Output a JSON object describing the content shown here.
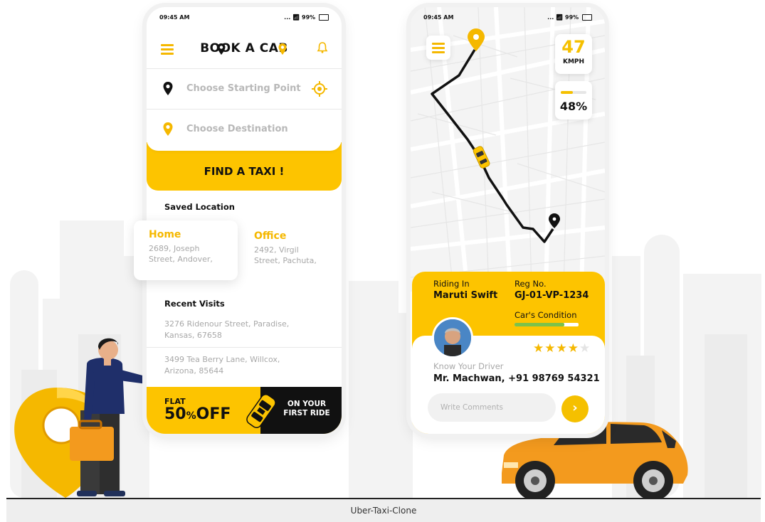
{
  "caption": "Uber-Taxi-Clone",
  "status_bar": {
    "time": "09:45 AM",
    "signal": "...",
    "battery": "99%"
  },
  "booking_screen": {
    "title": "BOOK A CAB",
    "starting_point_placeholder": "Choose Starting Point",
    "destination_placeholder": "Choose Destination",
    "find_button": "FIND A TAXI !",
    "saved_location_title": "Saved Location",
    "saved_locations": [
      {
        "name": "Home",
        "address_line1": "2689,  Joseph",
        "address_line2": "Street, Andover,"
      },
      {
        "name": "Office",
        "address_line1": "2492, Virgil",
        "address_line2": "Street, Pachuta,"
      }
    ],
    "recent_visits_title": "Recent Visits",
    "recent_visits": [
      {
        "line1": "3276  Ridenour Street, Paradise,",
        "line2": "Kansas, 67658"
      },
      {
        "line1": "3499  Tea Berry Lane, Willcox,",
        "line2": "Arizona, 85644"
      }
    ],
    "promo": {
      "flat": "FLAT",
      "discount": "50",
      "percent_sign": "%",
      "off": "OFF",
      "ride_line1": "ON YOUR",
      "ride_line2": "FIRST RIDE"
    }
  },
  "ride_screen": {
    "speed_value": "47",
    "speed_unit": "KMPH",
    "progress_percent": 48,
    "progress_label": "48%",
    "riding_in_label": "Riding In",
    "car_model": "Maruti Swift",
    "reg_label": "Reg No.",
    "reg_number": "GJ-01-VP-1234",
    "condition_label": "Car's Condition",
    "condition_fraction": 0.78,
    "rating": 4,
    "rating_max": 5,
    "know_driver_label": "Know Your Driver",
    "driver_name": "Mr. Machwan, +91 98769 54321",
    "comment_placeholder": "Write Comments"
  },
  "colors": {
    "accent": "#fdc400",
    "dark": "#111111",
    "muted": "#a8a8a8",
    "condition": "#7cc24a",
    "car": "#f39a1e"
  }
}
